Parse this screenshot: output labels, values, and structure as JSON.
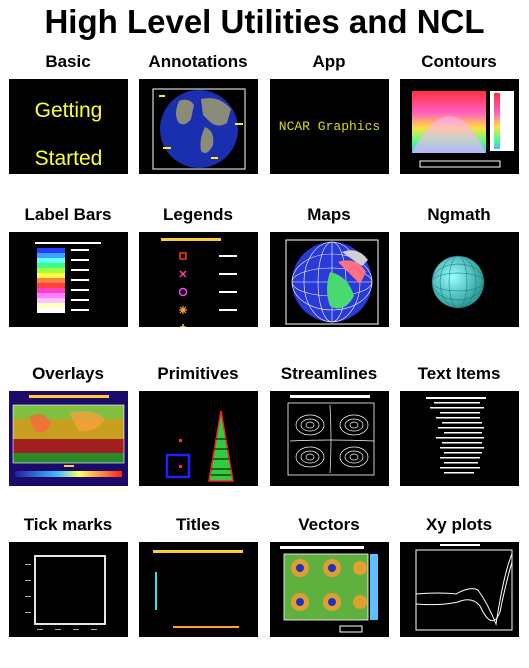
{
  "page_title": "High Level Utilities and NCL",
  "cells": [
    {
      "label": "Basic"
    },
    {
      "label": "Annotations"
    },
    {
      "label": "App"
    },
    {
      "label": "Contours"
    },
    {
      "label": "Label Bars"
    },
    {
      "label": "Legends"
    },
    {
      "label": "Maps"
    },
    {
      "label": "Ngmath"
    },
    {
      "label": "Overlays"
    },
    {
      "label": "Primitives"
    },
    {
      "label": "Streamlines"
    },
    {
      "label": "Text Items"
    },
    {
      "label": "Tick marks"
    },
    {
      "label": "Titles"
    },
    {
      "label": "Vectors"
    },
    {
      "label": "Xy plots"
    }
  ],
  "thumb_text": {
    "basic_line1": "Getting",
    "basic_line2": "Started",
    "app_text": "NCAR Graphics"
  }
}
